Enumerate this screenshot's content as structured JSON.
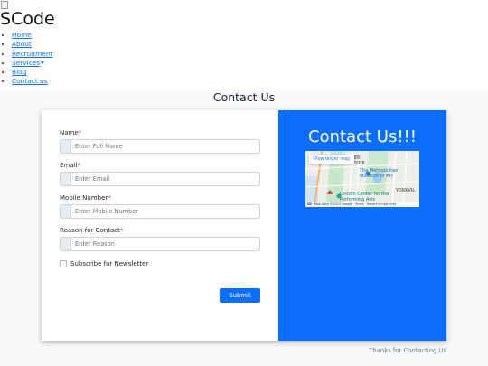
{
  "header": {
    "brand": "SCode",
    "nav": [
      {
        "label": "Home"
      },
      {
        "label": "About"
      },
      {
        "label": "Recruitment"
      },
      {
        "label": "Services"
      },
      {
        "label": "Blog"
      },
      {
        "label": "Contact us"
      }
    ]
  },
  "main": {
    "title": "Contact Us",
    "form": {
      "name": {
        "label": "Name",
        "required_mark": "*",
        "placeholder": "Enter Full Name"
      },
      "email": {
        "label": "Email",
        "required_mark": "*",
        "placeholder": "Enter Email"
      },
      "mobile": {
        "label": "Mobile Number",
        "required_mark": "*",
        "placeholder": "Enter Mobile Number"
      },
      "reason": {
        "label": "Reason for Contact",
        "required_mark": "*",
        "placeholder": "Enter Reason"
      },
      "newsletter_label": "Subscribe for Newsletter",
      "submit_label": "Submit"
    },
    "side": {
      "title": "Contact Us!!!",
      "map": {
        "view_larger": "View larger map",
        "labels": {
          "museum": "The Metropolitan Museum of Art",
          "lincoln": "Lincoln Center for the Performing Arts",
          "upper": "ER",
          "side": "SIDE",
          "yorkville": "YORKVIL"
        },
        "footer": {
          "keyboard": "⌨",
          "data": "Map data ©2023 Google",
          "terms": "Terms",
          "report": "Report a map error"
        }
      }
    },
    "footer_note": "Thanks for Contacting Us"
  },
  "colors": {
    "primary": "#0d6efd",
    "required": "#dc3545",
    "muted": "#6c757d",
    "background": "#f8f9fa"
  }
}
